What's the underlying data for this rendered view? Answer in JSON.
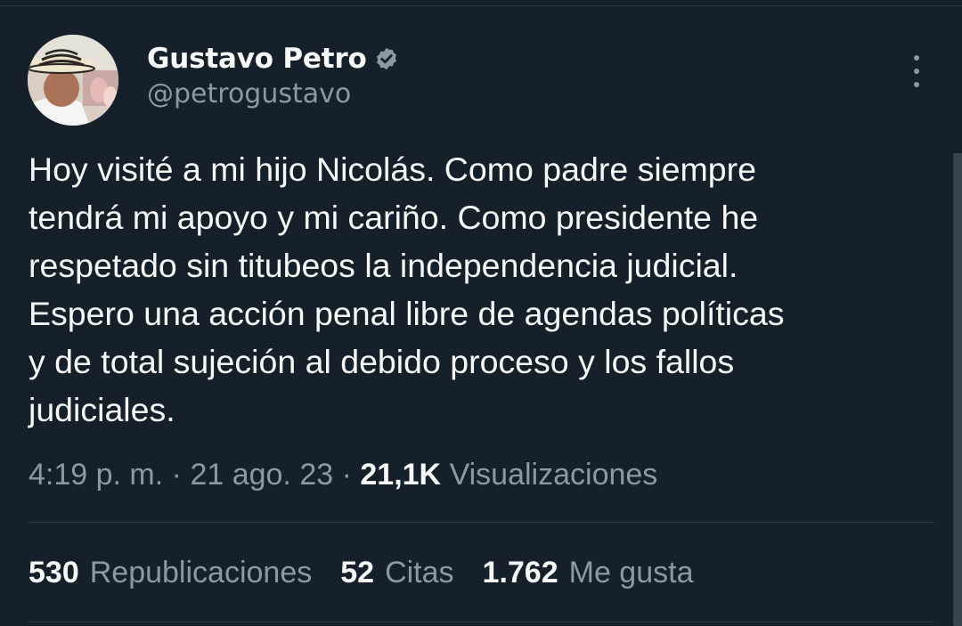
{
  "author": {
    "name": "Gustavo Petro",
    "handle": "@petrogustavo",
    "verified": true
  },
  "tweet": {
    "text": "Hoy visité a mi hijo Nicolás. Como padre siempre\ntendrá mi apoyo y mi cariño. Como presidente he\nrespetado sin titubeos la independencia judicial.\nEspero una acción penal libre de agendas políticas\ny de total sujeción al debido proceso y los fallos\njudiciales."
  },
  "meta": {
    "time": "4:19 p. m.",
    "separator": "·",
    "date": "21 ago. 23",
    "views_count": "21,1K",
    "views_label": "Visualizaciones"
  },
  "stats": {
    "retweets_count": "530",
    "retweets_label": "Republicaciones",
    "quotes_count": "52",
    "quotes_label": "Citas",
    "likes_count": "1.762",
    "likes_label": "Me gusta"
  },
  "colors": {
    "background": "#15202b",
    "text_primary": "#f7f9f9",
    "text_secondary": "#8b98a5",
    "divider": "#2f3b47"
  },
  "icons": {
    "verified": "verified-badge-icon",
    "more": "more-options-icon"
  }
}
